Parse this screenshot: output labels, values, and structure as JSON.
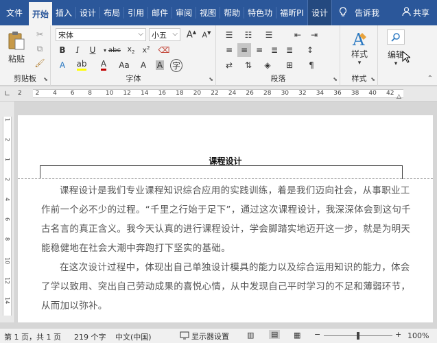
{
  "tabs": [
    {
      "key": "file",
      "label": "文件"
    },
    {
      "key": "home",
      "label": "开始",
      "active": true
    },
    {
      "key": "insert",
      "label": "插入"
    },
    {
      "key": "design",
      "label": "设计"
    },
    {
      "key": "layout",
      "label": "布局"
    },
    {
      "key": "references",
      "label": "引用"
    },
    {
      "key": "mailings",
      "label": "邮件"
    },
    {
      "key": "review",
      "label": "审阅"
    },
    {
      "key": "view",
      "label": "视图"
    },
    {
      "key": "help",
      "label": "帮助"
    },
    {
      "key": "special",
      "label": "特色功"
    },
    {
      "key": "foxit",
      "label": "福昕PI"
    },
    {
      "key": "design2",
      "label": "设计"
    }
  ],
  "tell_me": "告诉我",
  "share": "共享",
  "clipboard": {
    "paste_label": "粘贴",
    "group_label": "剪贴板"
  },
  "font": {
    "name": "宋体",
    "size": "小五",
    "group_label": "字体"
  },
  "paragraph": {
    "group_label": "段落"
  },
  "styles": {
    "button_label": "样式",
    "group_label": "样式"
  },
  "editing": {
    "button_label": "编辑"
  },
  "ruler": {
    "h_numbers": [
      "2",
      "2",
      "4",
      "6",
      "8",
      "10",
      "12",
      "14",
      "16",
      "18",
      "20",
      "22",
      "24",
      "26",
      "28",
      "30",
      "32",
      "34",
      "36",
      "38",
      "40",
      "42"
    ],
    "v_numbers": [
      "1",
      "2",
      "1",
      "2",
      "4",
      "6",
      "8",
      "10",
      "12",
      "14"
    ]
  },
  "document": {
    "header_title": "课程设计",
    "paragraphs": [
      {
        "lines": [
          "课程设计是我们专业课程知识综合应用的实践训练，着是我们迈向社会，从事职业工",
          "作前一个必不少的过程。“千里之行始于足下”，通过这次课程设计，我深深体会到这句千",
          "古名言的真正含义。我今天认真的进行课程设计，学会脚踏实地迈开这一步，就是为明天",
          "能稳健地在社会大潮中奔跑打下坚实的基础。"
        ]
      },
      {
        "lines": [
          "在这次设计过程中，体现出自己单独设计模具的能力以及综合运用知识的能力，体会",
          "了学以致用、突出自己劳动成果的喜悦心情，从中发现自己平时学习的不足和薄弱环节，",
          "从而加以弥补。"
        ]
      }
    ]
  },
  "status": {
    "page": "第 1 页，共 1 页",
    "words": "219 个字",
    "language": "中文(中国)",
    "display_settings": "显示器设置",
    "zoom": "100%"
  },
  "colors": {
    "accent": "#2b579a",
    "font_color": "#c00000",
    "highlight": "#ffff00"
  }
}
